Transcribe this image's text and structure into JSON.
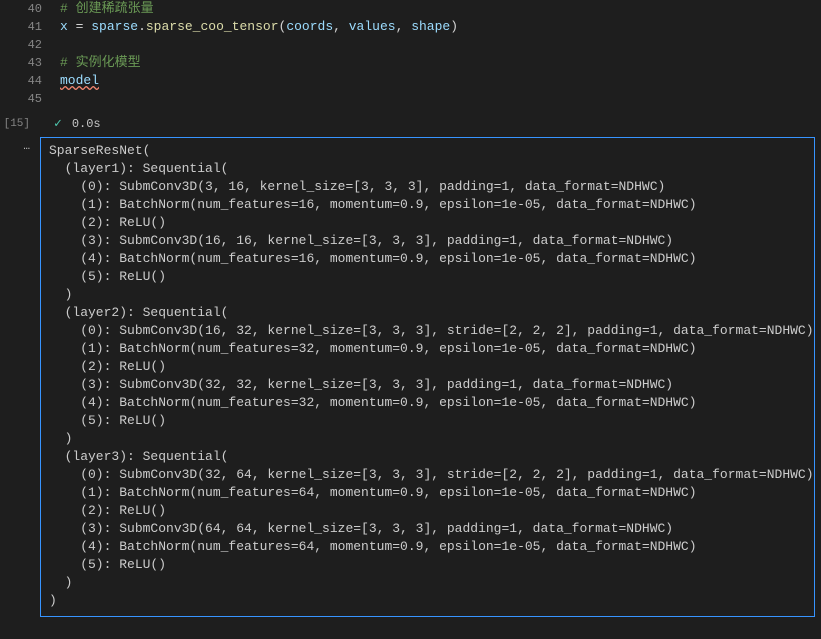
{
  "code": {
    "lines": [
      {
        "num": "40",
        "html": "<span class='comment'># 创建稀疏张量</span>"
      },
      {
        "num": "41",
        "html": "<span class='variable'>x</span> <span class='punct'>=</span> <span class='variable'>sparse</span><span class='punct'>.</span><span class='func'>sparse_coo_tensor</span><span class='punct'>(</span><span class='variable'>coords</span><span class='punct'>,</span> <span class='variable'>values</span><span class='punct'>,</span> <span class='variable'>shape</span><span class='punct'>)</span>"
      },
      {
        "num": "42",
        "html": ""
      },
      {
        "num": "43",
        "html": "<span class='comment'># 实例化模型</span>"
      },
      {
        "num": "44",
        "html": "<span class='variable wavy'>model</span>"
      },
      {
        "num": "45",
        "html": ""
      }
    ]
  },
  "execution": {
    "cell_label": "[15]",
    "status_icon": "✓",
    "timing": "0.0s",
    "ellipsis": "…"
  },
  "output": {
    "lines": [
      "SparseResNet(",
      "  (layer1): Sequential(",
      "    (0): SubmConv3D(3, 16, kernel_size=[3, 3, 3], padding=1, data_format=NDHWC)",
      "    (1): BatchNorm(num_features=16, momentum=0.9, epsilon=1e-05, data_format=NDHWC)",
      "    (2): ReLU()",
      "    (3): SubmConv3D(16, 16, kernel_size=[3, 3, 3], padding=1, data_format=NDHWC)",
      "    (4): BatchNorm(num_features=16, momentum=0.9, epsilon=1e-05, data_format=NDHWC)",
      "    (5): ReLU()",
      "  )",
      "  (layer2): Sequential(",
      "    (0): SubmConv3D(16, 32, kernel_size=[3, 3, 3], stride=[2, 2, 2], padding=1, data_format=NDHWC)",
      "    (1): BatchNorm(num_features=32, momentum=0.9, epsilon=1e-05, data_format=NDHWC)",
      "    (2): ReLU()",
      "    (3): SubmConv3D(32, 32, kernel_size=[3, 3, 3], padding=1, data_format=NDHWC)",
      "    (4): BatchNorm(num_features=32, momentum=0.9, epsilon=1e-05, data_format=NDHWC)",
      "    (5): ReLU()",
      "  )",
      "  (layer3): Sequential(",
      "    (0): SubmConv3D(32, 64, kernel_size=[3, 3, 3], stride=[2, 2, 2], padding=1, data_format=NDHWC)",
      "    (1): BatchNorm(num_features=64, momentum=0.9, epsilon=1e-05, data_format=NDHWC)",
      "    (2): ReLU()",
      "    (3): SubmConv3D(64, 64, kernel_size=[3, 3, 3], padding=1, data_format=NDHWC)",
      "    (4): BatchNorm(num_features=64, momentum=0.9, epsilon=1e-05, data_format=NDHWC)",
      "    (5): ReLU()",
      "  )",
      ")"
    ]
  }
}
